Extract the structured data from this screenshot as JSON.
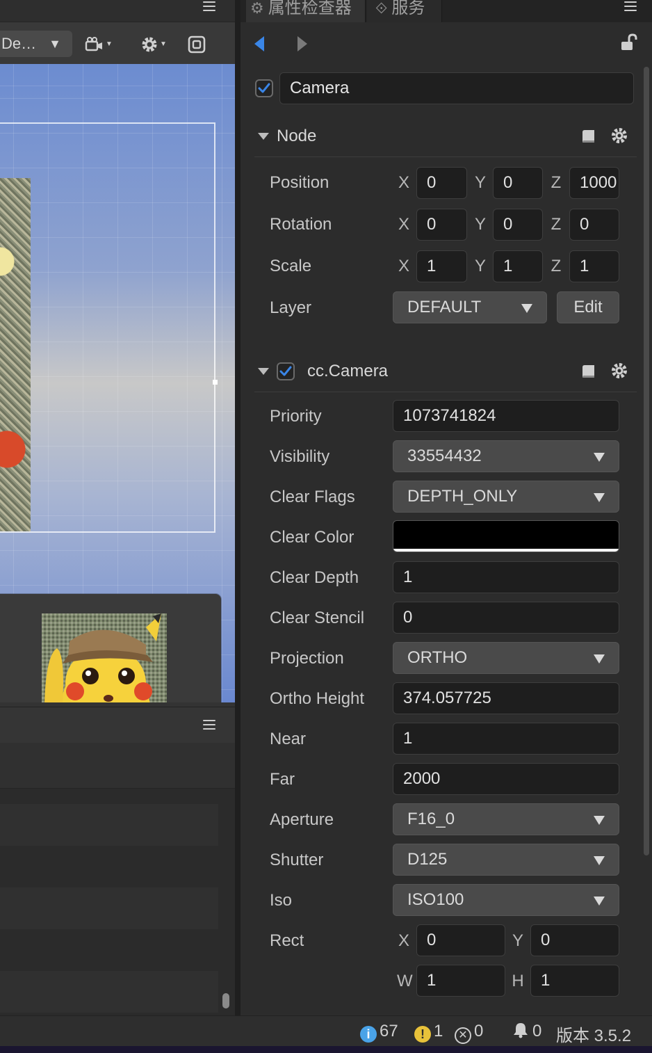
{
  "scene": {
    "camera_select_label": "De…"
  },
  "inspector": {
    "tabs": [
      {
        "label": "属性检查器",
        "icon": "gear-icon"
      },
      {
        "label": "服务",
        "icon": "link-icon"
      }
    ],
    "node": {
      "enabled": true,
      "name": "Camera"
    },
    "node_section": {
      "title": "Node",
      "position": {
        "label": "Position",
        "x": "0",
        "y": "0",
        "z": "1000"
      },
      "rotation": {
        "label": "Rotation",
        "x": "0",
        "y": "0",
        "z": "0"
      },
      "scale": {
        "label": "Scale",
        "x": "1",
        "y": "1",
        "z": "1"
      },
      "layer": {
        "label": "Layer",
        "value": "DEFAULT",
        "edit_label": "Edit"
      },
      "axis_labels": {
        "x": "X",
        "y": "Y",
        "z": "Z",
        "w": "W",
        "h": "H"
      }
    },
    "camera_section": {
      "title": "cc.Camera",
      "enabled": true,
      "priority": {
        "label": "Priority",
        "value": "1073741824"
      },
      "visibility": {
        "label": "Visibility",
        "value": "33554432"
      },
      "clear_flags": {
        "label": "Clear Flags",
        "value": "DEPTH_ONLY"
      },
      "clear_color": {
        "label": "Clear Color",
        "value": "#000000"
      },
      "clear_depth": {
        "label": "Clear Depth",
        "value": "1"
      },
      "clear_stencil": {
        "label": "Clear Stencil",
        "value": "0"
      },
      "projection": {
        "label": "Projection",
        "value": "ORTHO"
      },
      "ortho_height": {
        "label": "Ortho Height",
        "value": "374.057725"
      },
      "near": {
        "label": "Near",
        "value": "1"
      },
      "far": {
        "label": "Far",
        "value": "2000"
      },
      "aperture": {
        "label": "Aperture",
        "value": "F16_0"
      },
      "shutter": {
        "label": "Shutter",
        "value": "D125"
      },
      "iso": {
        "label": "Iso",
        "value": "ISO100"
      },
      "rect": {
        "label": "Rect",
        "x": "0",
        "y": "0",
        "w": "1",
        "h": "1"
      }
    }
  },
  "status": {
    "info_count": "67",
    "warning_count": "1",
    "error_count": "0",
    "notification_count": "0",
    "version": "版本 3.5.2"
  },
  "colors": {
    "accent": "#3a86e8",
    "info": "#4aa3e8",
    "warning": "#e8c23a"
  }
}
